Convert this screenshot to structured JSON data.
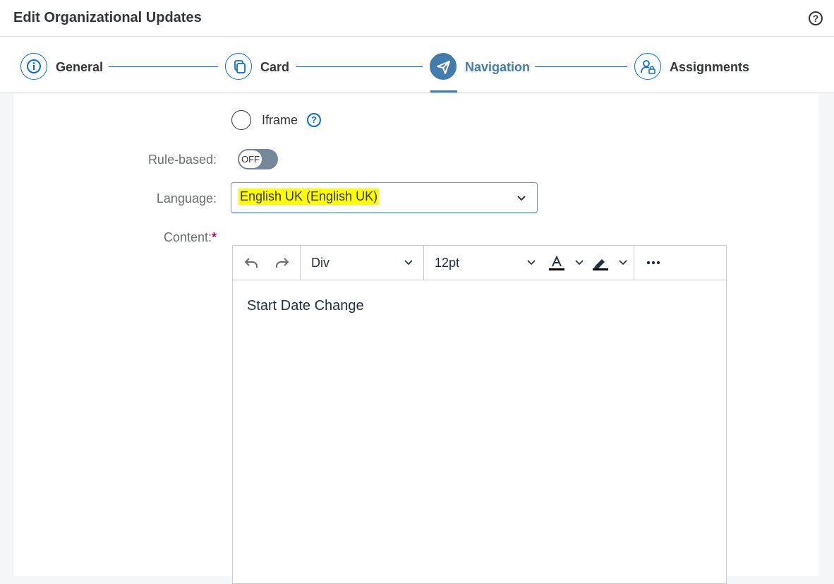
{
  "header": {
    "title": "Edit Organizational Updates",
    "help_icon": "help-circle-icon"
  },
  "wizard": {
    "steps": [
      {
        "label": "General",
        "icon": "info-icon",
        "active": false
      },
      {
        "label": "Card",
        "icon": "copy-icon",
        "active": false
      },
      {
        "label": "Navigation",
        "icon": "paper-plane-icon",
        "active": true
      },
      {
        "label": "Assignments",
        "icon": "user-lock-icon",
        "active": false
      }
    ],
    "accent_color": "#427cac"
  },
  "form": {
    "iframe_label": "Iframe",
    "rule_based_label": "Rule-based:",
    "rule_based_state": "OFF",
    "language_label": "Language:",
    "language_value": "English UK (English UK)",
    "content_label": "Content:",
    "required_marker": "*"
  },
  "editor": {
    "block_format": "Div",
    "font_size": "12pt",
    "content": "Start Date Change",
    "toolbar_icons": [
      "undo-icon",
      "redo-icon",
      "text-color-icon",
      "highlight-icon",
      "more-icon"
    ]
  }
}
